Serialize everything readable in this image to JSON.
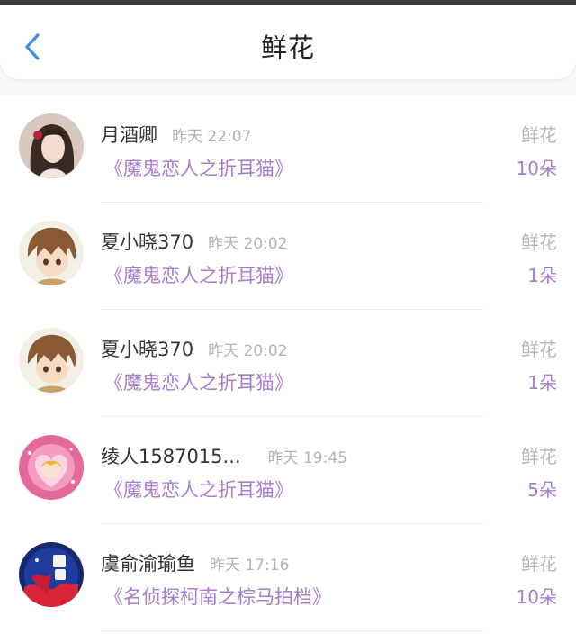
{
  "header": {
    "title": "鲜花",
    "back_icon": "chevron-left-icon",
    "accent": "#3d8de8"
  },
  "colors": {
    "book": "#a77dcc",
    "time": "#b3b3b3",
    "name": "#333333"
  },
  "items": [
    {
      "name": "月酒卿",
      "time": "昨天 22:07",
      "book": "《魔鬼恋人之折耳猫》",
      "kind": "鲜花",
      "count": "10朵"
    },
    {
      "name": "夏小晓370",
      "time": "昨天 20:02",
      "book": "《魔鬼恋人之折耳猫》",
      "kind": "鲜花",
      "count": "1朵"
    },
    {
      "name": "夏小晓370",
      "time": "昨天 20:02",
      "book": "《魔鬼恋人之折耳猫》",
      "kind": "鲜花",
      "count": "1朵"
    },
    {
      "name": "绫人1587015...",
      "time": "昨天 19:45",
      "book": "《魔鬼恋人之折耳猫》",
      "kind": "鲜花",
      "count": "5朵"
    },
    {
      "name": "虞俞渝瑜鱼",
      "time": "昨天 17:16",
      "book": "《名侦探柯南之棕马拍档》",
      "kind": "鲜花",
      "count": "10朵"
    }
  ]
}
